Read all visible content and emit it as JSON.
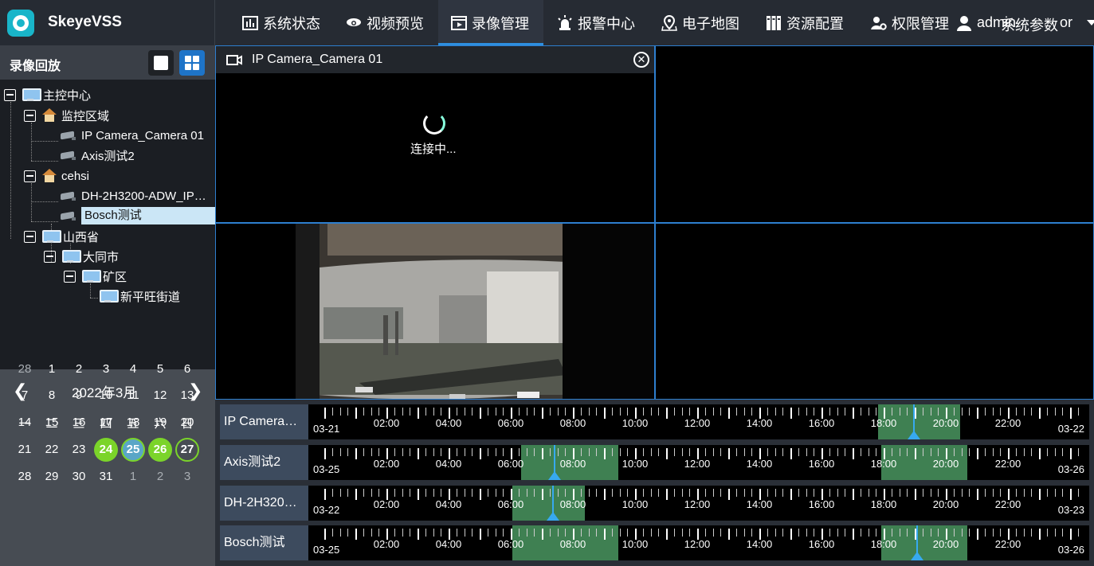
{
  "app": {
    "title": "SkeyeVSS"
  },
  "nav": [
    {
      "label": "系统状态"
    },
    {
      "label": "视频预览"
    },
    {
      "label": "录像管理"
    },
    {
      "label": "报警中心"
    },
    {
      "label": "电子地图"
    },
    {
      "label": "资源配置"
    },
    {
      "label": "权限管理"
    },
    {
      "label": "系统参数"
    }
  ],
  "user": {
    "name": "admin",
    "role_suffix": "or"
  },
  "sidebar": {
    "title": "录像回放",
    "tree": [
      {
        "label": "主控中心"
      },
      {
        "label": "监控区域"
      },
      {
        "label": "IP Camera_Camera 01"
      },
      {
        "label": "Axis测试2"
      },
      {
        "label": "cehsi"
      },
      {
        "label": "DH-2H3200-ADW_IP…"
      },
      {
        "label": "Bosch测试"
      },
      {
        "label": "山西省"
      },
      {
        "label": "大同市"
      },
      {
        "label": "矿区"
      },
      {
        "label": "新平旺街道"
      }
    ]
  },
  "calendar": {
    "title": "2022年3月",
    "weekdays": [
      "一",
      "二",
      "三",
      "四",
      "五",
      "六",
      "日"
    ],
    "days": [
      "28",
      "1",
      "2",
      "3",
      "4",
      "5",
      "6",
      "7",
      "8",
      "9",
      "10",
      "11",
      "12",
      "13",
      "14",
      "15",
      "16",
      "17",
      "18",
      "19",
      "20",
      "21",
      "22",
      "23",
      "24",
      "25",
      "26",
      "27",
      "28",
      "29",
      "30",
      "31",
      "1",
      "2",
      "3"
    ]
  },
  "video": {
    "cell1_title": "IP Camera_Camera 01",
    "connecting": "连接中..."
  },
  "timeline": {
    "hours": [
      "02:00",
      "04:00",
      "06:00",
      "08:00",
      "10:00",
      "12:00",
      "14:00",
      "16:00",
      "18:00",
      "20:00",
      "22:00"
    ],
    "rows": [
      {
        "label": "IP Camera…",
        "date_start": "03-21",
        "date_end": "03-22"
      },
      {
        "label": "Axis测试2",
        "date_start": "03-25",
        "date_end": "03-26"
      },
      {
        "label": "DH-2H320…",
        "date_start": "03-22",
        "date_end": "03-23"
      },
      {
        "label": "Bosch测试",
        "date_start": "03-25",
        "date_end": "03-26"
      }
    ]
  },
  "colors": {
    "accent": "#2e8fe0",
    "record_segment": "#3f8052",
    "cursor": "#37a9ef",
    "record_day": "#7bd42a"
  }
}
